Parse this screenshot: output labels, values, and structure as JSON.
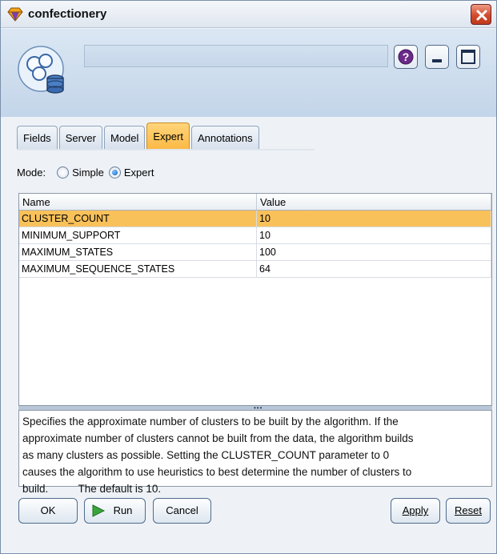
{
  "window": {
    "title": "confectionery"
  },
  "header": {
    "node_icon": "database-cluster-icon",
    "help_icon": "question-mark-icon",
    "minimize_icon": "minimize-icon",
    "maximize_icon": "maximize-icon"
  },
  "tabs": [
    {
      "label": "Fields"
    },
    {
      "label": "Server"
    },
    {
      "label": "Model"
    },
    {
      "label": "Expert",
      "active": true
    },
    {
      "label": "Annotations"
    }
  ],
  "mode": {
    "label": "Mode:",
    "options": [
      "Simple",
      "Expert"
    ],
    "selected": "Expert"
  },
  "table": {
    "columns": [
      "Name",
      "Value"
    ],
    "rows": [
      {
        "name": "CLUSTER_COUNT",
        "value": "10"
      },
      {
        "name": "MINIMUM_SUPPORT",
        "value": "10"
      },
      {
        "name": "MAXIMUM_STATES",
        "value": "100"
      },
      {
        "name": "MAXIMUM_SEQUENCE_STATES",
        "value": "64"
      }
    ],
    "selected_row": 0,
    "selected_color": "#f9c15a"
  },
  "description": {
    "lines": [
      "Specifies the approximate number of clusters to be built by the algorithm. If the",
      "approximate number of clusters cannot be built from the data, the algorithm builds",
      "as many clusters as possible. Setting the CLUSTER_COUNT parameter to 0",
      "causes the algorithm to use heuristics to best determine the number of clusters to",
      "build.          The default is 10."
    ]
  },
  "footer": {
    "ok_label": "OK",
    "run_label": "Run",
    "run_icon": "play-icon",
    "cancel_label": "Cancel",
    "apply_label": "Apply",
    "reset_label": "Reset"
  },
  "colors": {
    "active_tab": "#fbb844",
    "close_button": "#d24a2c",
    "header_bg": "#c3d5e9"
  }
}
